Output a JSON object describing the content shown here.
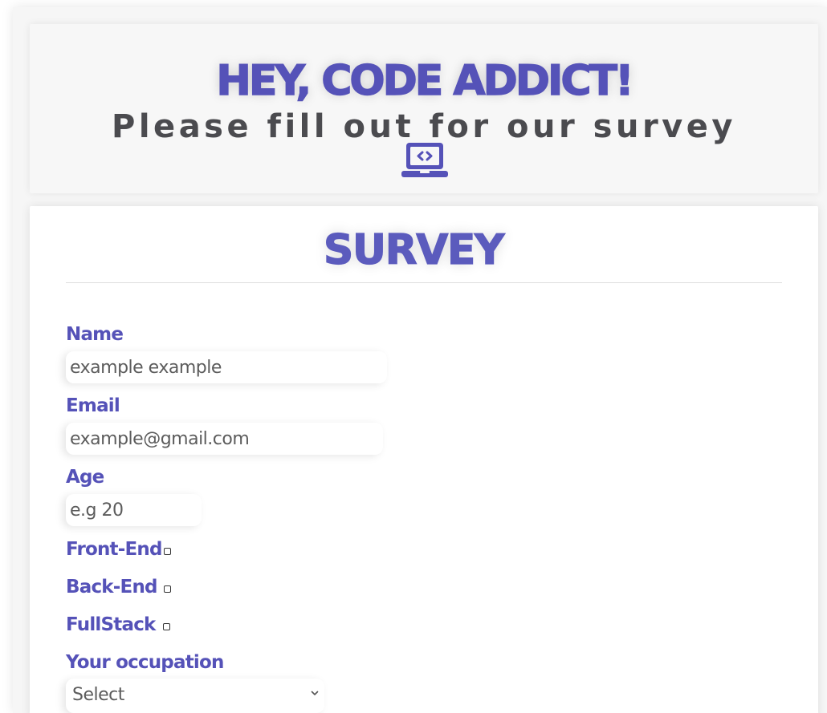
{
  "header": {
    "title": "HEY, CODE ADDICT!",
    "subtitle": "Please fill out for our survey",
    "icon": "laptop-code-icon"
  },
  "survey": {
    "title": "SURVEY",
    "fields": {
      "name": {
        "label": "Name",
        "placeholder": "example example"
      },
      "email": {
        "label": "Email",
        "placeholder": "example@gmail.com"
      },
      "age": {
        "label": "Age",
        "placeholder": "e.g 20"
      },
      "front_end": {
        "label": "Front-End",
        "checked": false
      },
      "back_end": {
        "label": "Back-End",
        "checked": false
      },
      "fullstack": {
        "label": "FullStack",
        "checked": false
      },
      "occupation": {
        "label": "Your occupation",
        "selected": "Select",
        "icon": "chevron-down-icon"
      }
    }
  },
  "colors": {
    "accent": "#5552b8",
    "subtitle": "#4b4b4f",
    "input_text": "#5c5c5c"
  }
}
